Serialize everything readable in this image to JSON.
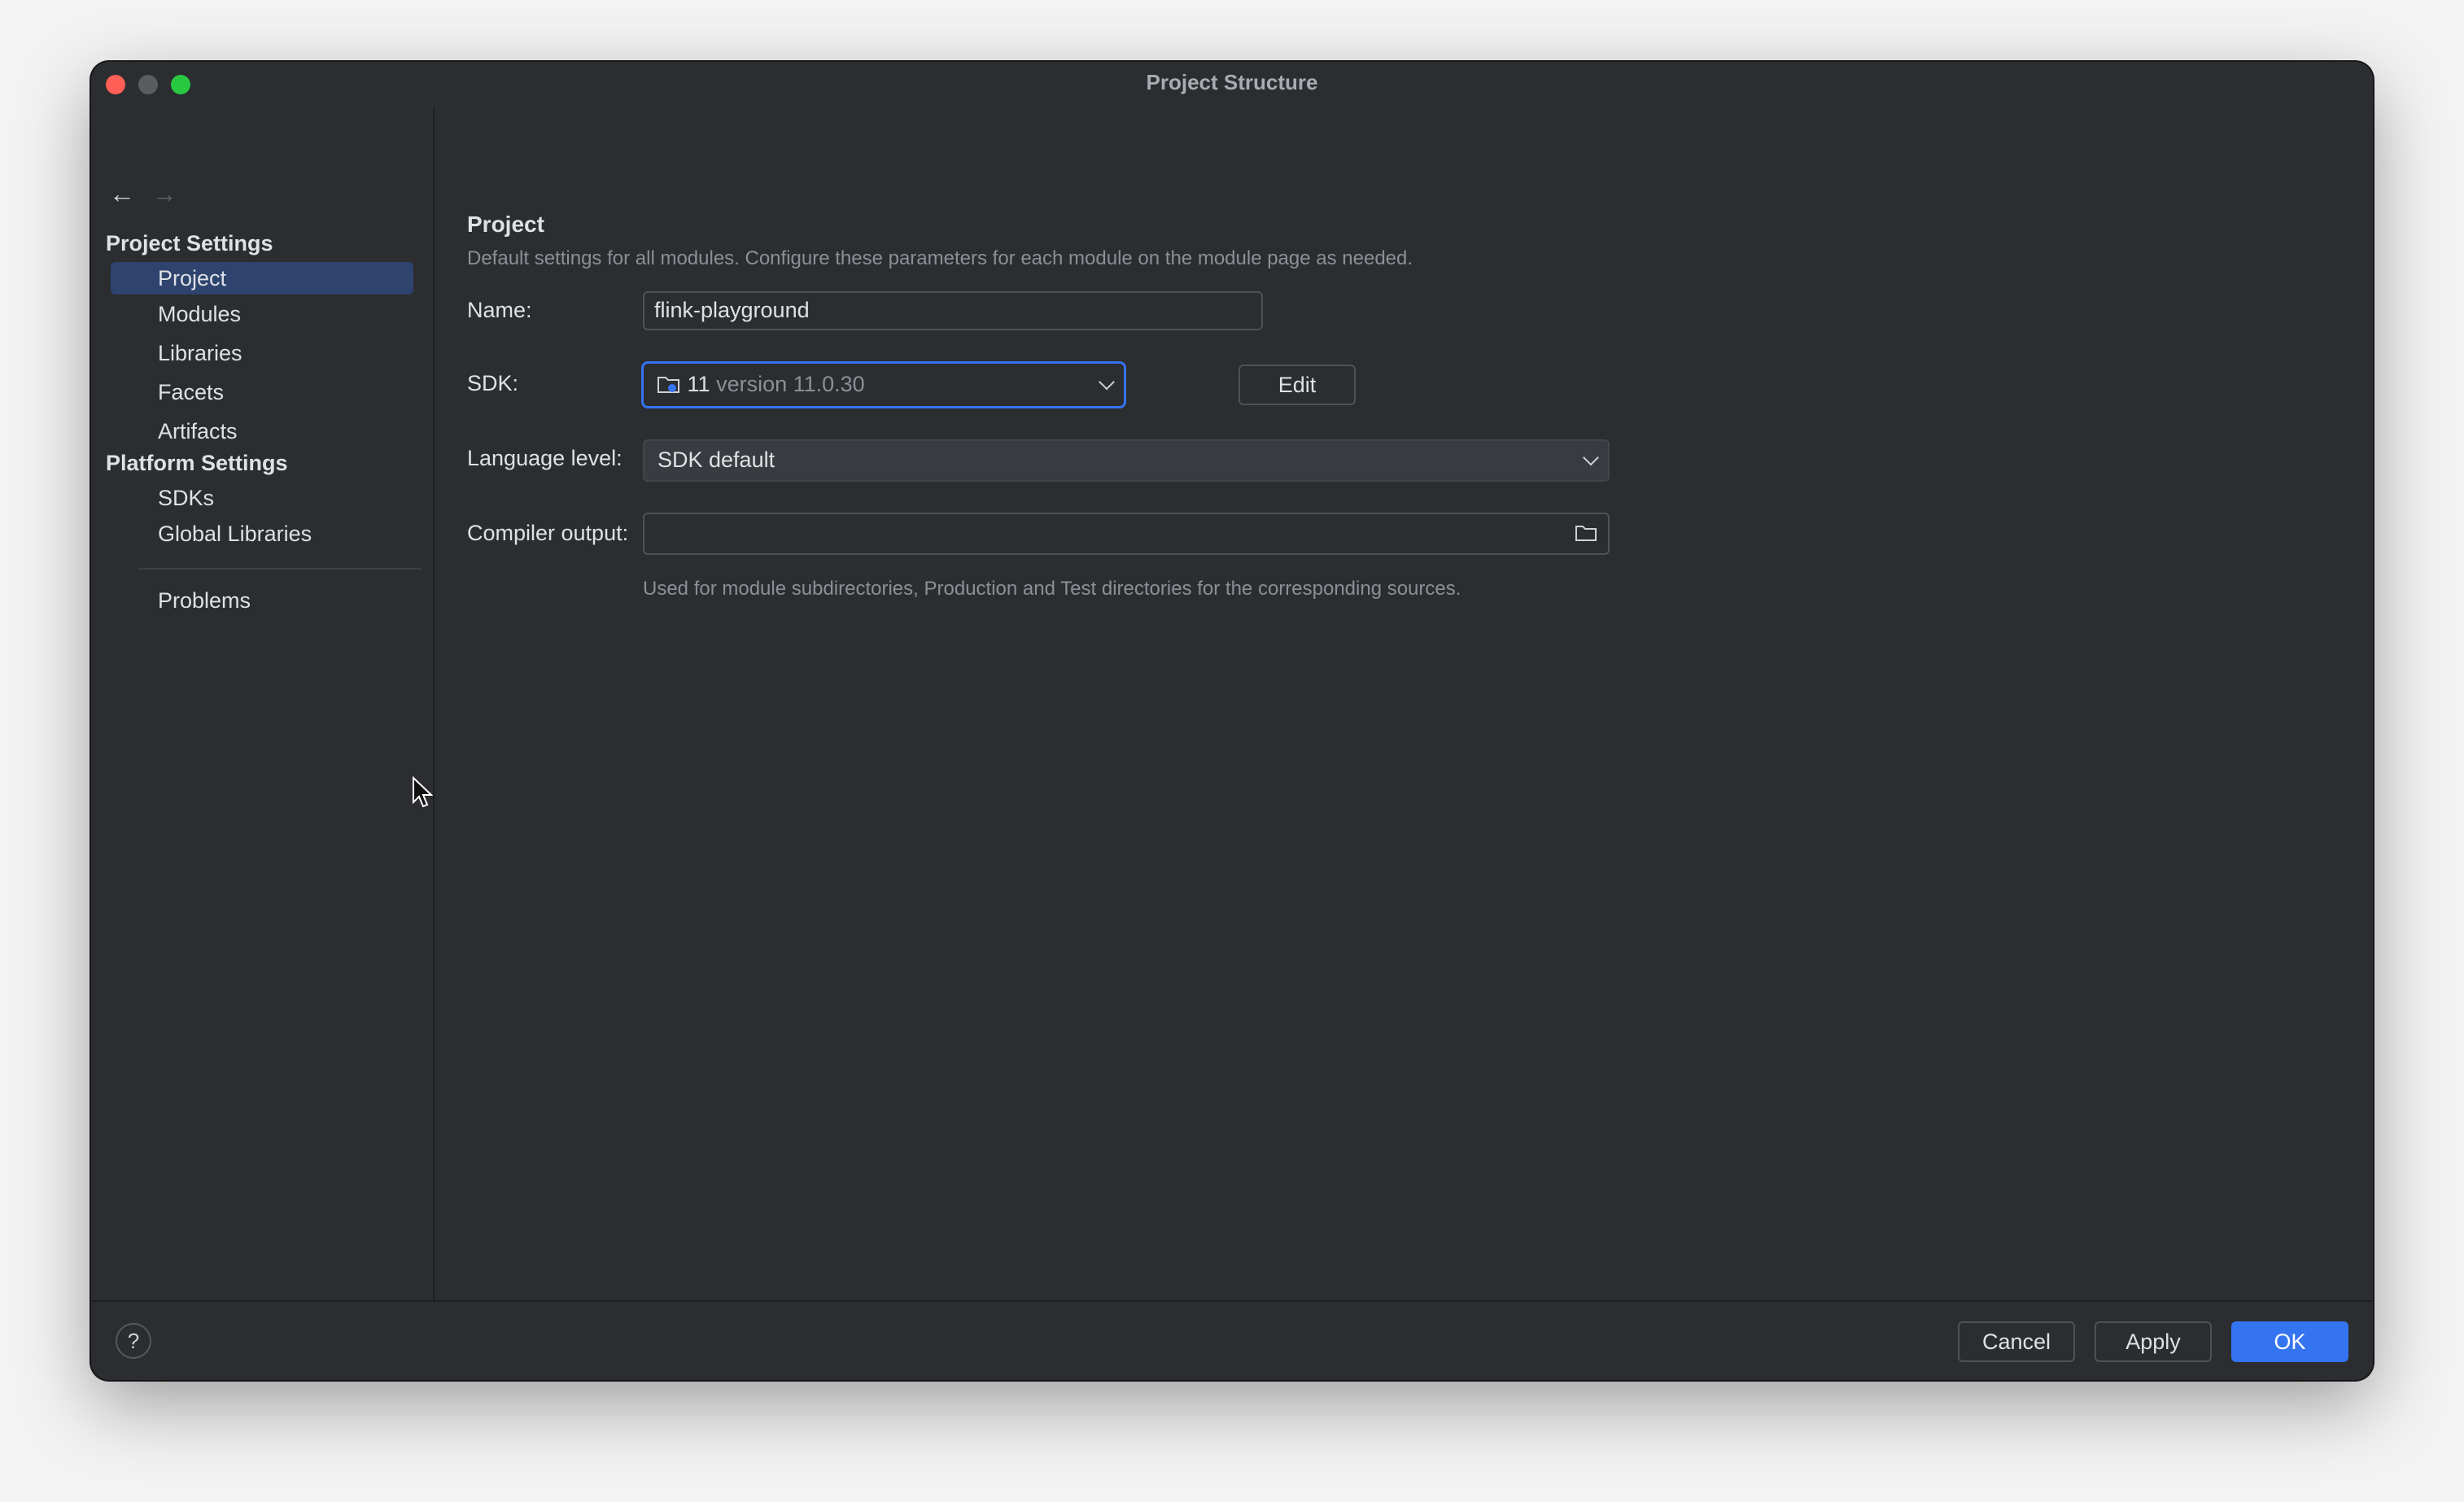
{
  "window": {
    "title": "Project Structure"
  },
  "sidebar": {
    "project_settings_header": "Project Settings",
    "project_items": [
      {
        "label": "Project",
        "selected": true
      },
      {
        "label": "Modules"
      },
      {
        "label": "Libraries"
      },
      {
        "label": "Facets"
      },
      {
        "label": "Artifacts"
      }
    ],
    "platform_settings_header": "Platform Settings",
    "platform_items": [
      {
        "label": "SDKs"
      },
      {
        "label": "Global Libraries"
      }
    ],
    "problems_label": "Problems"
  },
  "main": {
    "heading": "Project",
    "description": "Default settings for all modules. Configure these parameters for each module on the module page as needed.",
    "name_label": "Name:",
    "name_value": "flink-playground",
    "sdk_label": "SDK:",
    "sdk_number": "11",
    "sdk_version": "version 11.0.30",
    "edit_label": "Edit",
    "language_label": "Language level:",
    "language_value": "SDK default",
    "compiler_label": "Compiler output:",
    "compiler_value": "",
    "compiler_hint": "Used for module subdirectories, Production and Test directories for the corresponding sources."
  },
  "footer": {
    "help": "?",
    "cancel": "Cancel",
    "apply": "Apply",
    "ok": "OK"
  },
  "colors": {
    "accent": "#3574f0",
    "selection": "#2e436e",
    "background": "#2b2d30"
  }
}
